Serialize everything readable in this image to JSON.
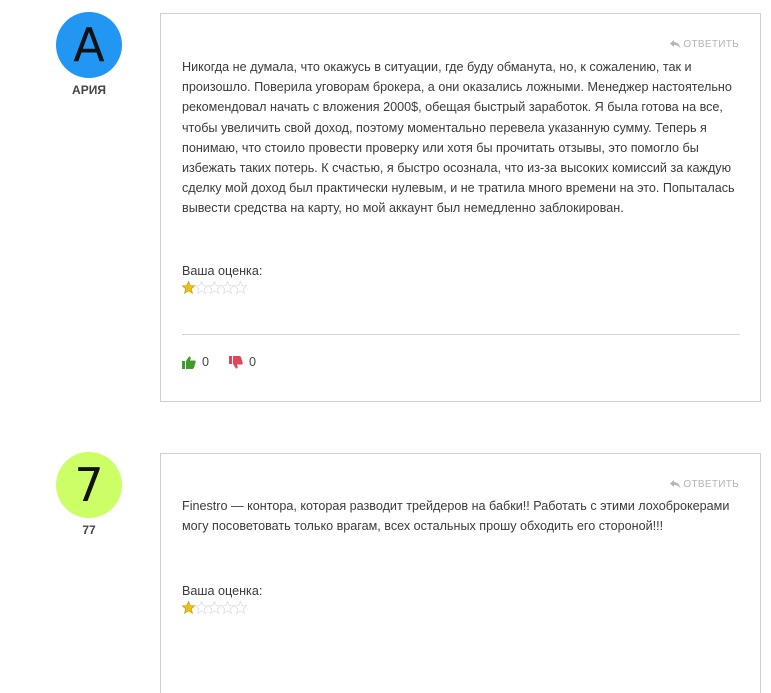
{
  "reviews": [
    {
      "avatar_letter": "А",
      "avatar_color": "#2196f3",
      "author": "АРИЯ",
      "reply_label": "ОТВЕТИТЬ",
      "text": "Никогда не думала, что окажусь в ситуации, где буду обманута, но, к сожалению, так и произошло. Поверила уговорам брокера, а они оказались ложными. Менеджер настоятельно рекомендовал начать с вложения 2000$, обещая быстрый заработок. Я была готова на все, чтобы увеличить свой доход, поэтому моментально перевела указанную сумму. Теперь я понимаю, что стоило провести проверку или хотя бы прочитать отзывы, это помогло бы избежать таких потерь. К счастью, я быстро осознала, что из-за высоких комиссий за каждую сделку мой доход был практически нулевым, и не тратила много времени на это. Попыталась вывести средства на карту, но мой аккаунт был немедленно заблокирован.",
      "rating_label": "Ваша оценка:",
      "rating": 1,
      "rating_max": 5,
      "likes": "0",
      "dislikes": "0"
    },
    {
      "avatar_letter": "7",
      "avatar_color": "#ccff66",
      "author": "77",
      "reply_label": "ОТВЕТИТЬ",
      "text": "Finestro — контора, которая разводит трейдеров на бабки!! Работать с этими лохоброкерами могу посоветовать только врагам, всех остальных прошу обходить его стороной!!!",
      "rating_label": "Ваша оценка:",
      "rating": 1,
      "rating_max": 5
    }
  ],
  "colors": {
    "like": "#3f9b2e",
    "dislike": "#e0455a",
    "star_filled": "#e8c21a",
    "star_empty": "#dddddd"
  }
}
